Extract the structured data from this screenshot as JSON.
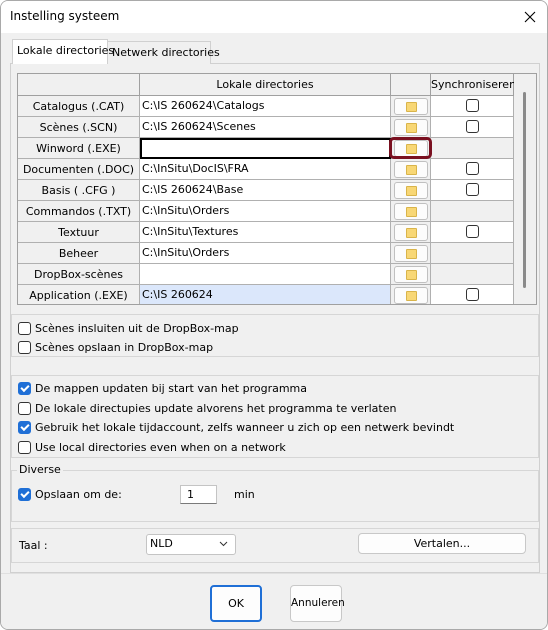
{
  "window": {
    "title": "Instelling systeem",
    "close_icon": "close-icon"
  },
  "tabs": [
    {
      "label": "Lokale directories",
      "active": true
    },
    {
      "label": "Netwerk directories",
      "active": false
    }
  ],
  "grid": {
    "headers": {
      "row_header": "",
      "path": "Lokale directories",
      "browse": "",
      "sync": "Synchroniseren"
    },
    "rows": [
      {
        "label": "Catalogus (.CAT)",
        "path": "C:\\IS 260624\\Catalogs",
        "sync": false,
        "has_sync": true
      },
      {
        "label": "Scènes (.SCN)",
        "path": "C:\\IS 260624\\Scenes",
        "sync": false,
        "has_sync": true
      },
      {
        "label": "Winword (.EXE)",
        "path": "",
        "sync": false,
        "has_sync": false,
        "active": true
      },
      {
        "label": "Documenten (.DOC)",
        "path": "C:\\InSitu\\DocIS\\FRA",
        "sync": false,
        "has_sync": true
      },
      {
        "label": "Basis ( .CFG )",
        "path": "C:\\IS 260624\\Base",
        "sync": false,
        "has_sync": true
      },
      {
        "label": "Commandos (.TXT)",
        "path": "C:\\InSitu\\Orders",
        "sync": false,
        "has_sync": false
      },
      {
        "label": "Textuur",
        "path": "C:\\InSitu\\Textures",
        "sync": false,
        "has_sync": true
      },
      {
        "label": "Beheer",
        "path": "C:\\InSitu\\Orders",
        "sync": false,
        "has_sync": false
      },
      {
        "label": "DropBox-scènes",
        "path": "",
        "sync": false,
        "has_sync": false
      },
      {
        "label": "Application (.EXE)",
        "path": "C:\\IS 260624",
        "sync": false,
        "has_sync": true,
        "highlight": true
      }
    ],
    "folder_icon": "folder-icon"
  },
  "dropbox_options": [
    {
      "label": "Scènes insluiten uit de DropBox-map",
      "checked": false
    },
    {
      "label": "Scènes opslaan in DropBox-map",
      "checked": false
    }
  ],
  "update_options": [
    {
      "label": "De mappen updaten bij start van het programma",
      "checked": true
    },
    {
      "label": "De lokale directupies update alvorens het programma te verlaten",
      "checked": false
    },
    {
      "label": "Gebruik het lokale tijdaccount, zelfs wanneer u zich op een netwerk bevindt",
      "checked": true
    },
    {
      "label": "Use local directories even when on a network",
      "checked": false
    }
  ],
  "diverse": {
    "legend": "Diverse",
    "save_label": "Opslaan om de:",
    "save_checked": true,
    "save_value": "1",
    "unit": "min"
  },
  "language": {
    "label": "Taal :",
    "value": "NLD",
    "translate_button": "Vertalen..."
  },
  "footer": {
    "ok": "OK",
    "cancel": "Annuleren"
  },
  "colors": {
    "accent": "#1f6fd6",
    "highlight_ring": "#7a1020",
    "selected_row": "#dbe7fb"
  }
}
